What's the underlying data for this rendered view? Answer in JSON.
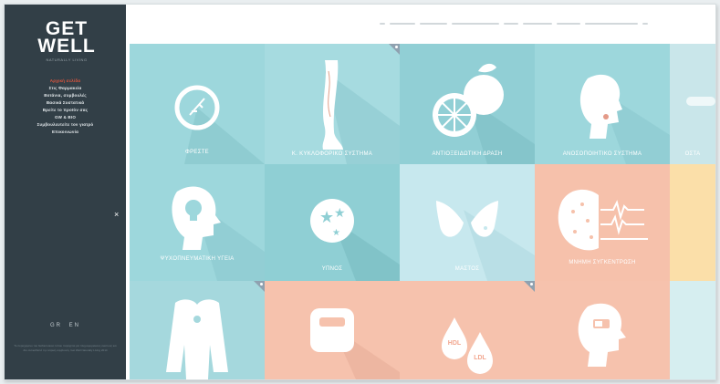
{
  "brand": {
    "line1": "GET",
    "line2": "WELL",
    "tagline": "NATURALLY LIVING"
  },
  "sidebar": {
    "menu": [
      {
        "label": "Αρχική σελίδα",
        "active": true
      },
      {
        "label": "Στις Φαρμακεία",
        "active": false
      },
      {
        "label": "Βοτάνια, συμβουλές",
        "active": false
      },
      {
        "label": "Βασικά Συστατικά",
        "active": false
      },
      {
        "label": "Βρείτε το προϊόν σας",
        "active": false
      },
      {
        "label": "GW & BIO",
        "active": false
      },
      {
        "label": "Συμβουλευτείτε τον γιατρό",
        "active": false
      },
      {
        "label": "Επικοινωνία",
        "active": false
      }
    ],
    "close_glyph": "×",
    "languages": [
      "GR",
      "EN"
    ],
    "footer": "Το περιεχόμενο του διαδικτυακού τόπου παρέχεται για πληροφοριακούς σκοπούς και δεν αντικαθιστά την ιατρική συμβουλή. Get Well Naturally Living 2014"
  },
  "tiles": [
    {
      "label": "ΦΡΕΣΤΕ",
      "color": "#9dd7dc",
      "icon": "stomach-icon"
    },
    {
      "label": "Κ. ΚΥΚΛΟΦΟΡΙΚΟ ΣΥΣΤΗΜΑ",
      "color": "#a6dbe0",
      "icon": "leg-icon"
    },
    {
      "label": "ΑΝΤΙΟΞΕΙΔΩΤΙΚΗ ΔΡΑΣΗ",
      "color": "#91cfd5",
      "icon": "orange-icon"
    },
    {
      "label": "ΑΝΟΣΟΠΟΙΗΤΙΚΟ ΣΥΣΤΗΜΑ",
      "color": "#9dd7dc",
      "icon": "head-cough-icon"
    },
    {
      "label": "ΟΣΤΑ",
      "color": "#c9e6ea",
      "icon": "bone-icon"
    },
    {
      "label": "ΨΥΧΟΠΝΕΥΜΑΤΙΚΗ ΥΓΕΙΑ",
      "color": "#9dd7dc",
      "icon": "mind-bulb-icon"
    },
    {
      "label": "ΥΠΝΟΣ",
      "color": "#8fcfd4",
      "icon": "sleep-stars-icon"
    },
    {
      "label": "ΜΑΣΤΟΣ",
      "color": "#c7e8ee",
      "icon": "breast-icon"
    },
    {
      "label": "ΜΝΗΜΗ ΣΥΓΚΕΝΤΡΩΣΗ",
      "color": "#f6c1ab",
      "icon": "brain-icon"
    },
    {
      "label": "",
      "color": "#fbdfa9",
      "icon": "none"
    },
    {
      "label": "",
      "color": "#a5d8dd",
      "icon": "torso-icon"
    },
    {
      "label": "",
      "color": "#f6c2ad",
      "icon": "scale-icon"
    },
    {
      "label": "",
      "color": "#f6c2ad",
      "icon": "hdl-ldl-icon"
    },
    {
      "label": "",
      "color": "#f6c2ad",
      "icon": "head-battery-icon"
    },
    {
      "label": "",
      "color": "#d6eef0",
      "icon": "none"
    }
  ],
  "cholesterol": {
    "hdl": "HDL",
    "ldl": "LDL"
  }
}
